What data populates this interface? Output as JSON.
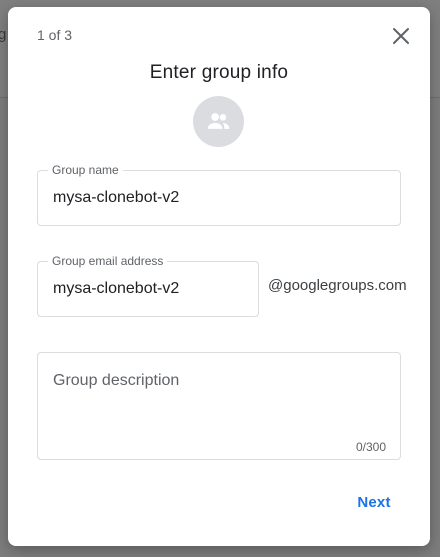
{
  "background": {
    "fragment_text": "g"
  },
  "dialog": {
    "step_indicator": "1 of 3",
    "title": "Enter group info",
    "close_icon": "close-icon",
    "avatar_icon": "group-icon",
    "group_name": {
      "label": "Group name",
      "value": "mysa-clonebot-v2"
    },
    "group_email": {
      "label": "Group email address",
      "value": "mysa-clonebot-v2",
      "domain_suffix": "@googlegroups.com"
    },
    "group_description": {
      "placeholder": "Group description",
      "value": "",
      "counter": "0/300"
    },
    "next_label": "Next"
  },
  "colors": {
    "accent": "#1a73e8",
    "scrim": "#7d7d7d",
    "border": "#dadce0",
    "text_secondary": "#5f6368"
  }
}
